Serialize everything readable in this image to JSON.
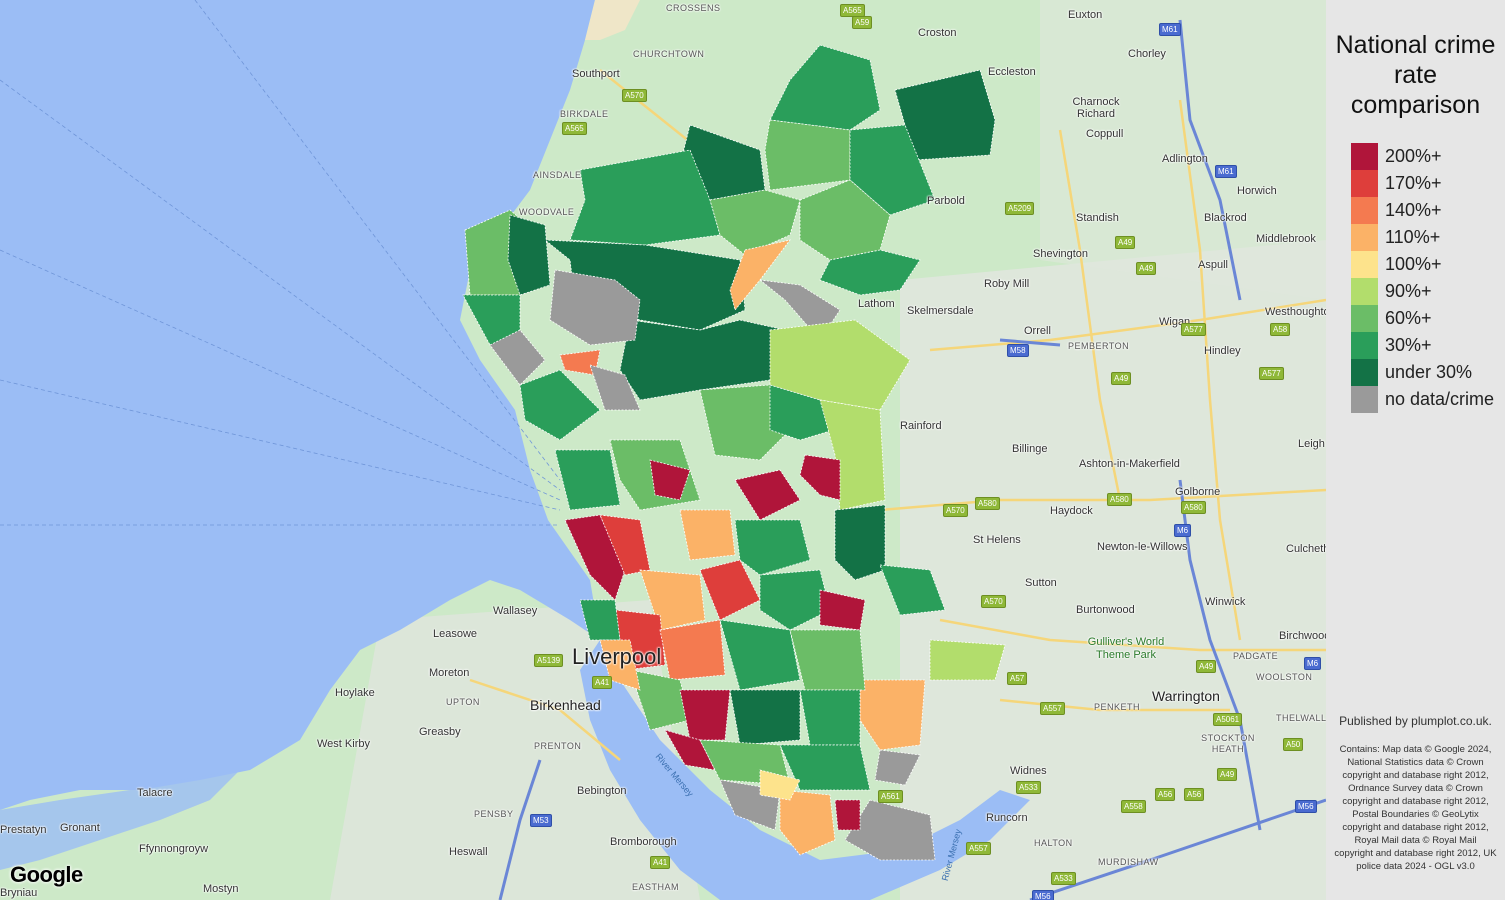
{
  "legend": {
    "title": "National crime rate comparison",
    "items": [
      {
        "label": "200%+",
        "color": "#b0153a"
      },
      {
        "label": "170%+",
        "color": "#de3e3b"
      },
      {
        "label": "140%+",
        "color": "#f47a50"
      },
      {
        "label": "110%+",
        "color": "#fbb267"
      },
      {
        "label": "100%+",
        "color": "#fde38c"
      },
      {
        "label": "90%+",
        "color": "#b2dd6c"
      },
      {
        "label": "60%+",
        "color": "#6bbd67"
      },
      {
        "label": "30%+",
        "color": "#2a9e5a"
      },
      {
        "label": "under 30%",
        "color": "#137246"
      },
      {
        "label": "no data/crime",
        "color": "#9a9a9a"
      }
    ]
  },
  "attribution": {
    "publisher": "Published by plumplot.co.uk.",
    "contains": "Contains: Map data © Google 2024, National Statistics data © Crown copyright and database right 2012, Ordnance Survey data © Crown copyright and database right 2012, Postal Boundaries © GeoLytix copyright and database right 2012, Royal Mail data © Royal Mail copyright and database right 2012, UK police data 2024 - OGL v3.0"
  },
  "google_logo": "Google",
  "places": [
    {
      "name": "CROSSENS",
      "kind": "small"
    },
    {
      "name": "Euxton",
      "kind": "town"
    },
    {
      "name": "Croston",
      "kind": "town"
    },
    {
      "name": "CHURCHTOWN",
      "kind": "small"
    },
    {
      "name": "Chorley",
      "kind": "town"
    },
    {
      "name": "Eccleston",
      "kind": "town"
    },
    {
      "name": "Southport",
      "kind": "town"
    },
    {
      "name": "Charnock Richard",
      "kind": "town"
    },
    {
      "name": "BIRKDALE",
      "kind": "small"
    },
    {
      "name": "Coppull",
      "kind": "town"
    },
    {
      "name": "Adlington",
      "kind": "town"
    },
    {
      "name": "AINSDALE",
      "kind": "small"
    },
    {
      "name": "Horwich",
      "kind": "town"
    },
    {
      "name": "WOODVALE",
      "kind": "small"
    },
    {
      "name": "Parbold",
      "kind": "town"
    },
    {
      "name": "Standish",
      "kind": "town"
    },
    {
      "name": "Blackrod",
      "kind": "town"
    },
    {
      "name": "Middlebrook",
      "kind": "town"
    },
    {
      "name": "Shevington",
      "kind": "town"
    },
    {
      "name": "Aspull",
      "kind": "town"
    },
    {
      "name": "Roby Mill",
      "kind": "town"
    },
    {
      "name": "Lathom",
      "kind": "town"
    },
    {
      "name": "Skelmersdale",
      "kind": "town"
    },
    {
      "name": "Westhoughton",
      "kind": "town"
    },
    {
      "name": "Orrell",
      "kind": "town"
    },
    {
      "name": "Wigan",
      "kind": "town"
    },
    {
      "name": "PEMBERTON",
      "kind": "small"
    },
    {
      "name": "Hindley",
      "kind": "town"
    },
    {
      "name": "Rainford",
      "kind": "town"
    },
    {
      "name": "Billinge",
      "kind": "town"
    },
    {
      "name": "Leigh",
      "kind": "town"
    },
    {
      "name": "Ashton-in-Makerfield",
      "kind": "town"
    },
    {
      "name": "Golborne",
      "kind": "town"
    },
    {
      "name": "Haydock",
      "kind": "town"
    },
    {
      "name": "St Helens",
      "kind": "town"
    },
    {
      "name": "Newton-le-Willows",
      "kind": "town"
    },
    {
      "name": "Culcheth",
      "kind": "town"
    },
    {
      "name": "Sutton",
      "kind": "town"
    },
    {
      "name": "Winwick",
      "kind": "town"
    },
    {
      "name": "Burtonwood",
      "kind": "town"
    },
    {
      "name": "Birchwood",
      "kind": "town"
    },
    {
      "name": "Wallasey",
      "kind": "town"
    },
    {
      "name": "Gulliver's World Theme Park",
      "kind": "poi"
    },
    {
      "name": "Leasowe",
      "kind": "town"
    },
    {
      "name": "PADGATE",
      "kind": "small"
    },
    {
      "name": "Liverpool",
      "kind": "big"
    },
    {
      "name": "Moreton",
      "kind": "town"
    },
    {
      "name": "WOOLSTON",
      "kind": "small"
    },
    {
      "name": "Hoylake",
      "kind": "town"
    },
    {
      "name": "UPTON",
      "kind": "small"
    },
    {
      "name": "Birkenhead",
      "kind": "med"
    },
    {
      "name": "Warrington",
      "kind": "med"
    },
    {
      "name": "PENKETH",
      "kind": "small"
    },
    {
      "name": "THELWALL",
      "kind": "small"
    },
    {
      "name": "West Kirby",
      "kind": "town"
    },
    {
      "name": "Greasby",
      "kind": "town"
    },
    {
      "name": "PRENTON",
      "kind": "small"
    },
    {
      "name": "STOCKTON HEATH",
      "kind": "small"
    },
    {
      "name": "Widnes",
      "kind": "town"
    },
    {
      "name": "River Mersey",
      "kind": "water"
    },
    {
      "name": "Talacre",
      "kind": "town"
    },
    {
      "name": "Bebington",
      "kind": "town"
    },
    {
      "name": "PENSBY",
      "kind": "small"
    },
    {
      "name": "Prestatyn",
      "kind": "town"
    },
    {
      "name": "Gronant",
      "kind": "town"
    },
    {
      "name": "Runcorn",
      "kind": "town"
    },
    {
      "name": "Ffynnongroyw",
      "kind": "town"
    },
    {
      "name": "Bromborough",
      "kind": "town"
    },
    {
      "name": "HALTON",
      "kind": "small"
    },
    {
      "name": "Heswall",
      "kind": "town"
    },
    {
      "name": "MURDISHAW",
      "kind": "small"
    },
    {
      "name": "Mostyn",
      "kind": "town"
    },
    {
      "name": "EASTHAM",
      "kind": "small"
    },
    {
      "name": "Bryniau",
      "kind": "town"
    },
    {
      "name": "River Mersey",
      "kind": "water"
    }
  ],
  "roads": [
    "A565",
    "A59",
    "M61",
    "A570",
    "A565",
    "M61",
    "A5209",
    "A49",
    "A49",
    "A577",
    "A58",
    "M58",
    "A49",
    "A577",
    "A580",
    "A570",
    "A580",
    "A580",
    "M6",
    "A570",
    "M6",
    "A5139",
    "A49",
    "A41",
    "A57",
    "A557",
    "A5061",
    "A50",
    "A533",
    "A56",
    "A49",
    "A558",
    "A56",
    "M56",
    "M53",
    "A557",
    "A533",
    "A41",
    "M56",
    "A561"
  ]
}
